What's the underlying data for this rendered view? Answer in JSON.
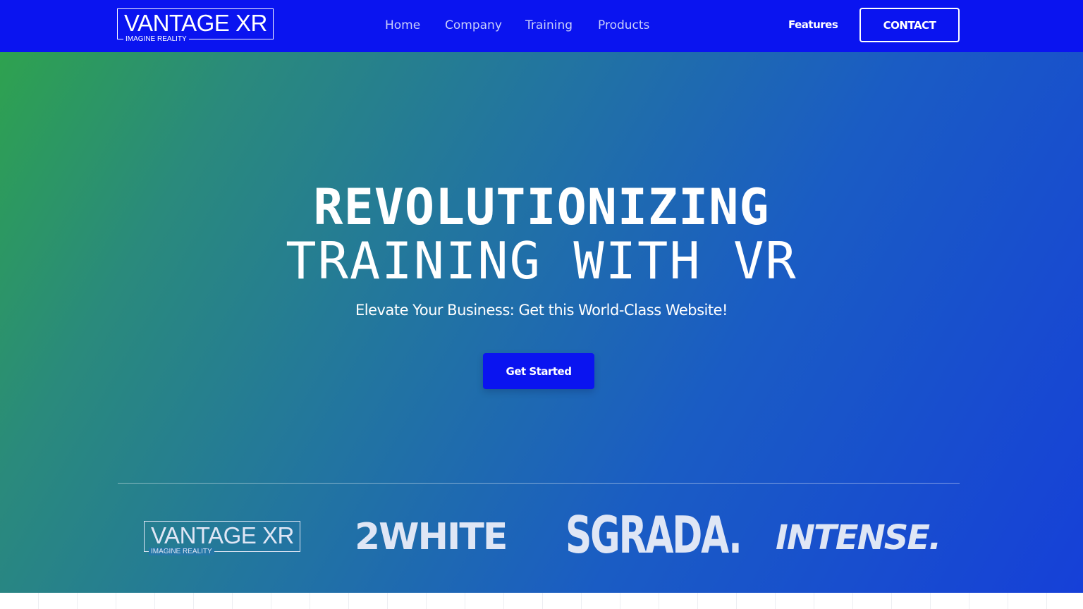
{
  "header": {
    "logo": {
      "title": "VANTAGE XR",
      "tagline": "IMAGINE REALITY"
    },
    "nav": [
      {
        "label": "Home"
      },
      {
        "label": "Company"
      },
      {
        "label": "Training"
      },
      {
        "label": "Products"
      }
    ],
    "features_label": "Features",
    "contact_label": "CONTACT"
  },
  "hero": {
    "headline_line1": "REVOLUTIONIZING",
    "headline_line2": "TRAINING WITH VR",
    "subheading": "Elevate Your Business: Get this World-Class Website!",
    "cta_label": "Get Started"
  },
  "partners": {
    "vantage": {
      "title": "VANTAGE XR",
      "tagline": "IMAGINE REALITY"
    },
    "twowhite": "2WHITE",
    "sgrada": "SGRADA.",
    "intense": "INTENSE."
  },
  "colors": {
    "nav_bg": "#0a14f0",
    "cta_bg": "#0a14f0",
    "gradient_start": "#2ea24f",
    "gradient_end": "#1640d8"
  }
}
